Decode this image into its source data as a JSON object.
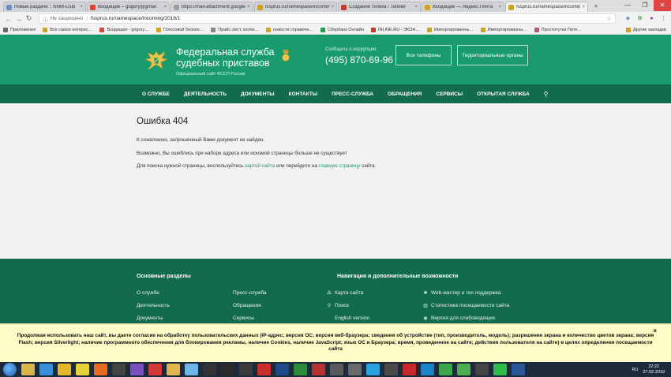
{
  "browser": {
    "tabs": [
      {
        "title": "Новые раздачи :: NNM-Club",
        "color": "#6a8fc4",
        "active": false
      },
      {
        "title": "Входящие – grigory@gmail",
        "color": "#d44638",
        "active": false
      },
      {
        "title": "https://mail-attachment.googleu…",
        "color": "#9e9e9e",
        "active": false
      },
      {
        "title": "fssprus.ru/namespace/incoming",
        "color": "#c9a227",
        "active": false
      },
      {
        "title": "Создание топика / Топики",
        "color": "#c0392b",
        "active": false
      },
      {
        "title": "Входящие — Яндекс.Почта",
        "color": "#d6a21e",
        "active": false
      },
      {
        "title": "fssprus.ru/namespace/incoming",
        "color": "#c9a227",
        "active": true
      }
    ],
    "close_glyph": "×",
    "new_tab_glyph": "+",
    "window_controls": {
      "minimize": "—",
      "maximize": "❐",
      "close": "✕"
    },
    "nav": {
      "back": "←",
      "forward": "→",
      "reload": "↻"
    },
    "address": {
      "security_icon": "warning-icon",
      "security_glyph": "ⓘ",
      "security_text": "Не защищено",
      "separator": "|",
      "url": "fssprus.ru/namespace/incoming/2016/1",
      "star_glyph": "☆"
    },
    "extensions": [
      {
        "name": "shield-extension-icon",
        "glyph": "◈",
        "color": "#3b7bd8"
      },
      {
        "name": "leaf-extension-icon",
        "glyph": "✿",
        "color": "#2e9e4f"
      },
      {
        "name": "profile-avatar",
        "glyph": "●",
        "color": "#8a3fbf"
      },
      {
        "name": "menu-icon",
        "glyph": "⋮",
        "color": "#555555"
      }
    ],
    "bookmarks": [
      {
        "label": "Приложения",
        "color": "#6a6a6a"
      },
      {
        "label": "Все самое интерес…",
        "color": "#c9a227"
      },
      {
        "label": "Входящие - grigory…",
        "color": "#d44638"
      },
      {
        "label": "Голосовой блокно…",
        "color": "#d6a21e"
      },
      {
        "label": "Прайс-лист, коопе…",
        "color": "#888888"
      },
      {
        "label": "новости справочн…",
        "color": "#c9a227"
      },
      {
        "label": "Сбербанк Онлайн",
        "color": "#1f9e47"
      },
      {
        "label": "INLINE.RU - ЭКОН…",
        "color": "#c0392b"
      },
      {
        "label": "Импортированны…",
        "color": "#c9a227"
      },
      {
        "label": "Импортированны…",
        "color": "#c9a227"
      },
      {
        "label": "Проститутки Пите…",
        "color": "#b05a7a"
      }
    ],
    "bookmarks_other": "Другие закладки"
  },
  "header": {
    "title_line1": "Федеральная служба",
    "title_line2": "судебных приставов",
    "subtitle": "Официальный сайт ФССП России",
    "corruption_label": "Сообщить о коррупции:",
    "phone": "(495) 870-69-96",
    "btn_all_phones": "Все телефоны",
    "btn_territorial": "Территориальные органы",
    "colors": {
      "header_bg": "#1a9b6e",
      "nav_bg": "#136b4d"
    }
  },
  "mainnav": {
    "items": [
      "О СЛУЖБЕ",
      "ДЕЯТЕЛЬНОСТЬ",
      "ДОКУМЕНТЫ",
      "КОНТАКТЫ",
      "ПРЕСС-СЛУЖБА",
      "ОБРАЩЕНИЯ",
      "СЕРВИСЫ",
      "ОТКРЫТАЯ СЛУЖБА"
    ],
    "search_glyph": "⚲"
  },
  "content": {
    "title": "Ошибка 404",
    "p1": "К сожалению, запрошенный Вами документ не найден.",
    "p2": "Возможно, Вы ошиблись при наборе адреса или искомой страницы больше не существует",
    "p3_before": "Для поиска нужной страницы, воспользуйтесь ",
    "p3_link1": "картой сайта",
    "p3_middle": " или перейдите на ",
    "p3_link2": "главную страницу",
    "p3_after": " сайта."
  },
  "footer": {
    "heading_sections": "Основные разделы",
    "heading_nav": "Навигация и дополнительные возможности",
    "col1": [
      "О службе",
      "Деятельность",
      "Документы"
    ],
    "col2": [
      "Пресс-служба",
      "Обращения",
      "Сервисы"
    ],
    "col3": [
      {
        "label": "Карта сайта",
        "icon": "sitemap-icon",
        "glyph": "⁂"
      },
      {
        "label": "Поиск",
        "icon": "search-icon",
        "glyph": "⚲"
      },
      {
        "label": "English version",
        "icon": "",
        "glyph": ""
      }
    ],
    "col4": [
      {
        "label": "Web-мастер и тех.поддержка",
        "icon": "gear-icon",
        "glyph": "✱"
      },
      {
        "label": "Статистика посещаемости сайта",
        "icon": "stats-icon",
        "glyph": "▥"
      },
      {
        "label": "Версия для слабовидящих",
        "icon": "eye-icon",
        "glyph": "◉"
      }
    ]
  },
  "cookie": {
    "text": "Продолжая использовать наш сайт, вы даете согласие на обработку пользовательских данных (IP-адрес; версия ОС; версия веб-браузера; сведения об устройстве (тип, производитель, модель); разрешение экрана и количество цветов экрана; версия Flash; версия Silverlight; наличие программного обеспечения для блокирования рекламы, наличие Cookies, наличие JavaScript; язык ОС и Браузера; время, проведенное на сайте; действия пользователя на сайте) в целях определения посещаемости сайта",
    "close_glyph": "×"
  },
  "taskbar": {
    "apps": [
      {
        "name": "explorer-taskbar-icon",
        "color": "#d9b44a"
      },
      {
        "name": "ie-taskbar-icon",
        "color": "#3a8fd8"
      },
      {
        "name": "chrome-taskbar-icon",
        "color": "#e4b72b"
      },
      {
        "name": "batman-taskbar-icon",
        "color": "#e8d23a"
      },
      {
        "name": "firefox-taskbar-icon",
        "color": "#e66a1f"
      },
      {
        "name": "media-taskbar-icon",
        "color": "#444444"
      },
      {
        "name": "visual-studio-taskbar-icon",
        "color": "#7b4fc4"
      },
      {
        "name": "opera-taskbar-icon",
        "color": "#d23a3a"
      },
      {
        "name": "folder-taskbar-icon",
        "color": "#e0b64a"
      },
      {
        "name": "paint-taskbar-icon",
        "color": "#6fb5e8"
      },
      {
        "name": "app-taskbar-icon-11",
        "color": "#333333"
      },
      {
        "name": "app-taskbar-icon-12",
        "color": "#2a2a2a"
      },
      {
        "name": "app-taskbar-icon-13",
        "color": "#3c3c3c"
      },
      {
        "name": "acrobat-taskbar-icon",
        "color": "#c9302c"
      },
      {
        "name": "app-taskbar-icon-15",
        "color": "#1f4a8a"
      },
      {
        "name": "dreamweaver-taskbar-icon",
        "color": "#2d8a3a"
      },
      {
        "name": "app-taskbar-icon-17",
        "color": "#b83232"
      },
      {
        "name": "app-taskbar-icon-18",
        "color": "#5a5a5a"
      },
      {
        "name": "app-taskbar-icon-19",
        "color": "#6a6a6a"
      },
      {
        "name": "skype-taskbar-icon",
        "color": "#2aa0de"
      },
      {
        "name": "app-taskbar-icon-21",
        "color": "#4a4a4a"
      },
      {
        "name": "app-taskbar-icon-22",
        "color": "#c8282a"
      },
      {
        "name": "app-taskbar-icon-23",
        "color": "#1b84c8"
      },
      {
        "name": "app-taskbar-icon-24",
        "color": "#3da54a"
      },
      {
        "name": "app-taskbar-icon-25",
        "color": "#4bae4f"
      },
      {
        "name": "app-taskbar-icon-26",
        "color": "#444444"
      },
      {
        "name": "whatsapp-taskbar-icon",
        "color": "#2fbd4a"
      },
      {
        "name": "word-taskbar-icon",
        "color": "#2b5797"
      }
    ],
    "lang": "RU",
    "time": "22:22",
    "date": "27.02.2019"
  }
}
